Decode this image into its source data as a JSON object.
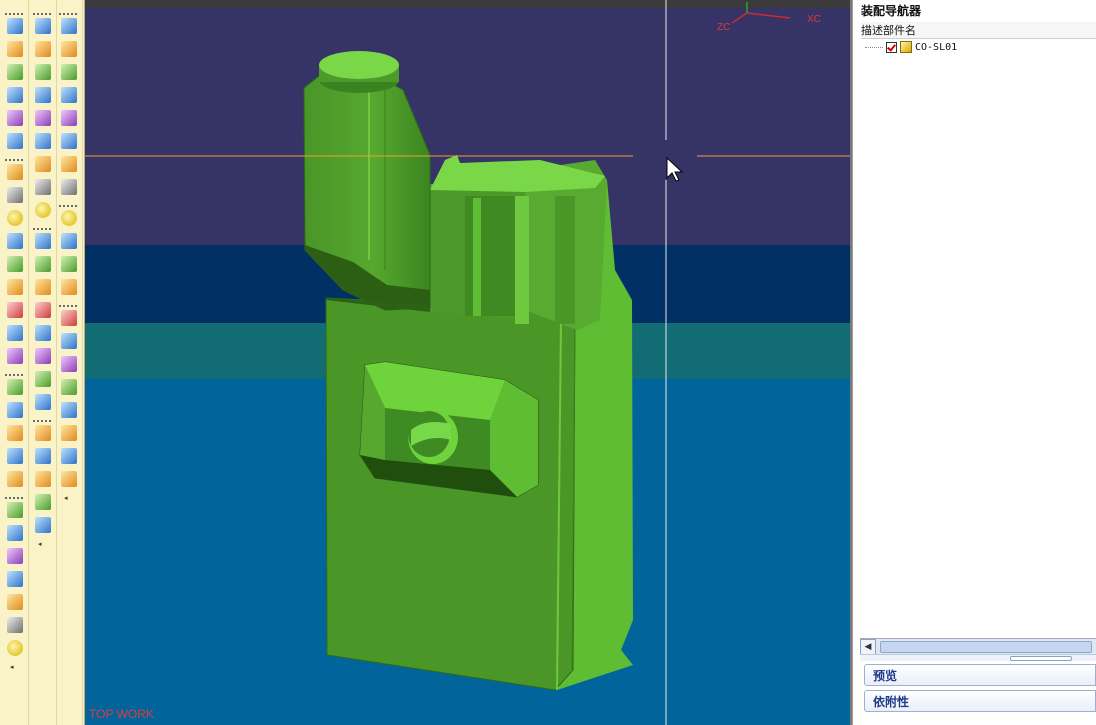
{
  "viewport": {
    "label": "TOP WORK",
    "axes": {
      "x": "XC",
      "z": "ZC"
    },
    "colors": {
      "band_top": "#363367",
      "band_2": "#013164",
      "band_3": "#126c74",
      "band_4": "#01659b",
      "part": "#4f9e2c",
      "part_light": "#6fd43c",
      "crosshair_h": "#e8a23a",
      "crosshair_v": "#e8e8e8"
    }
  },
  "navigator": {
    "title": "装配导航器",
    "column_header": "描述部件名",
    "items": [
      {
        "label": "CO-SL01",
        "checked": true
      }
    ],
    "buttons": {
      "preview": "预览",
      "dependencies": "依附性"
    }
  },
  "toolbar": {
    "col1": [
      "sketch-icon",
      "extrude-icon",
      "revolve-icon",
      "sweep-icon",
      "tube-icon",
      "block-icon",
      "cylinder-icon",
      "cone-icon",
      "sphere-icon",
      "hole-icon",
      "boss-icon",
      "pocket-icon",
      "pad-icon",
      "slot-icon",
      "groove-icon",
      "feature-icon",
      "thread-icon",
      "trim-icon",
      "shell-icon",
      "offset-icon",
      "blend-icon",
      "chamfer-icon",
      "draft-icon",
      "block2-icon",
      "cylinder2-icon",
      "cone2-icon",
      "sphere2-icon"
    ],
    "col2": [
      "unite-icon",
      "subtract-icon",
      "intersect-icon",
      "sew-icon",
      "patch-icon",
      "split-icon",
      "book-icon",
      "instance-icon",
      "mirror-icon",
      "extract-icon",
      "scale-icon",
      "wrap-icon",
      "unwrap-icon",
      "surface-icon",
      "edge-icon",
      "face-icon",
      "thicken-icon",
      "layer-icon",
      "box-icon",
      "analysis-icon",
      "section-icon",
      "move-icon"
    ],
    "col3": [
      "view-icon",
      "fit-icon",
      "rotate-icon",
      "pan-icon",
      "zoom-icon",
      "shade-icon",
      "wire-icon",
      "hidden-icon",
      "render-icon",
      "measure-icon",
      "info-icon",
      "datum-icon",
      "csys-icon",
      "point-icon",
      "plane-icon",
      "axis-icon",
      "x-icon",
      "link-icon",
      "constraint-icon",
      "reposition-icon"
    ]
  }
}
